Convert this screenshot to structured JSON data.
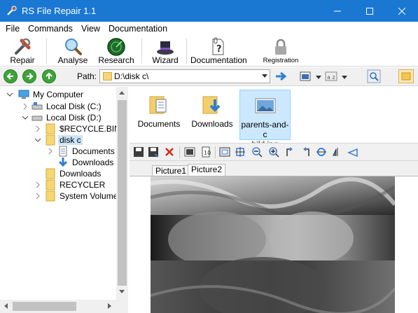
{
  "window": {
    "title": "RS File Repair 1.1"
  },
  "menu": [
    "File",
    "Commands",
    "View",
    "Documentation"
  ],
  "toolbar": {
    "repair": "Repair",
    "analyse": "Analyse",
    "research": "Research",
    "wizard": "Wizard",
    "documentation": "Documentation",
    "registration": "Registration"
  },
  "path": {
    "label": "Path:",
    "value": "D:\\disk c\\"
  },
  "tree": {
    "items": [
      {
        "label": "My Computer",
        "icon": "computer-icon"
      },
      {
        "label": "Local Disk (C:)",
        "icon": "drive-icon"
      },
      {
        "label": "Local Disk (D:)",
        "icon": "drive-icon"
      },
      {
        "label": "$RECYCLE.BIN",
        "icon": "folder-icon"
      },
      {
        "label": "disk c",
        "icon": "folder-icon"
      },
      {
        "label": "Documents",
        "icon": "documents-icon"
      },
      {
        "label": "Downloads",
        "icon": "downloads-icon"
      },
      {
        "label": "Downloads",
        "icon": "folder-icon"
      },
      {
        "label": "RECYCLER",
        "icon": "folder-icon"
      },
      {
        "label": "System Volume",
        "icon": "folder-icon"
      }
    ]
  },
  "files": {
    "items": [
      {
        "label": "Documents",
        "icon": "documents-folder-icon"
      },
      {
        "label": "Downloads",
        "icon": "downloads-folder-icon"
      },
      {
        "label_line1": "parents-and-c",
        "label_line2": "hild.jpg",
        "icon": "image-file-icon",
        "selected": true
      }
    ]
  },
  "viewer": {
    "tabs": [
      "Picture1",
      "Picture2"
    ],
    "active_tab": "Picture2"
  },
  "colors": {
    "titlebar": "#1a78d3",
    "selection": "#cce8ff",
    "nav_green": "#3ea33a"
  }
}
